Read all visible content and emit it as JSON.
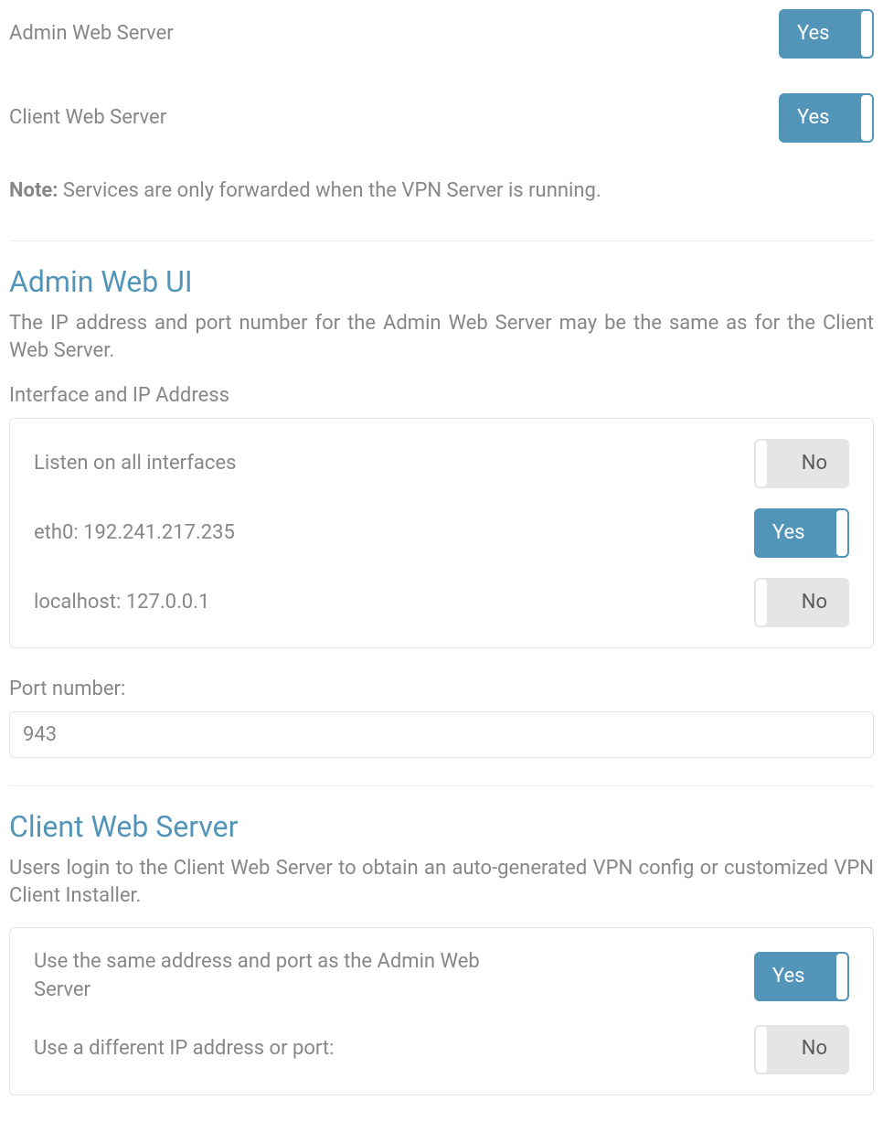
{
  "top_toggles": {
    "admin_web_server": {
      "label": "Admin Web Server",
      "value": "Yes",
      "state": "yes"
    },
    "client_web_server": {
      "label": "Client Web Server",
      "value": "Yes",
      "state": "yes"
    }
  },
  "note": {
    "prefix": "Note:",
    "text": " Services are only forwarded when the VPN Server is running."
  },
  "admin_web_ui": {
    "title": "Admin Web UI",
    "description": "The IP address and port number for the Admin Web Server may be the same as for the Client Web Server.",
    "interface_label": "Interface and IP Address",
    "interfaces": [
      {
        "label": "Listen on all interfaces",
        "value": "No",
        "state": "no"
      },
      {
        "label": "eth0: 192.241.217.235",
        "value": "Yes",
        "state": "yes"
      },
      {
        "label": "localhost: 127.0.0.1",
        "value": "No",
        "state": "no"
      }
    ],
    "port_label": "Port number:",
    "port_value": "943"
  },
  "client_web_server": {
    "title": "Client Web Server",
    "description": "Users login to the Client Web Server to obtain an auto-generated VPN config or customized VPN Client Installer.",
    "options": [
      {
        "label": "Use the same address and port as the Admin Web Server",
        "value": "Yes",
        "state": "yes"
      },
      {
        "label": "Use a different IP address or port:",
        "value": "No",
        "state": "no"
      }
    ]
  }
}
